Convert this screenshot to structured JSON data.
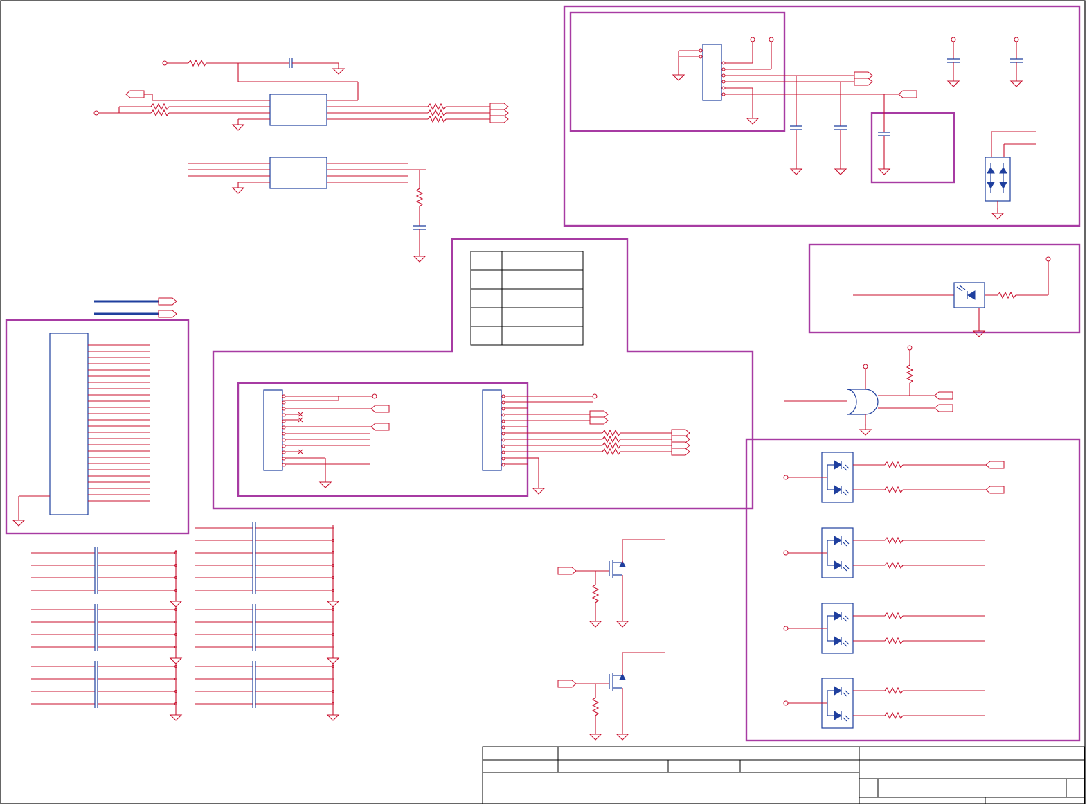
{
  "sheet": {
    "title_block": {},
    "colors": {
      "wire": "#c8102e",
      "component": "#1f3f9e",
      "group_box": "#a73ba3",
      "frame": "#000000",
      "background": "#ffffff"
    },
    "icons": [
      "resistor-icon",
      "capacitor-icon",
      "ground-icon",
      "diode-icon",
      "led-icon",
      "mosfet-icon",
      "and-gate-icon",
      "net-port-icon",
      "power-pin-icon"
    ]
  }
}
